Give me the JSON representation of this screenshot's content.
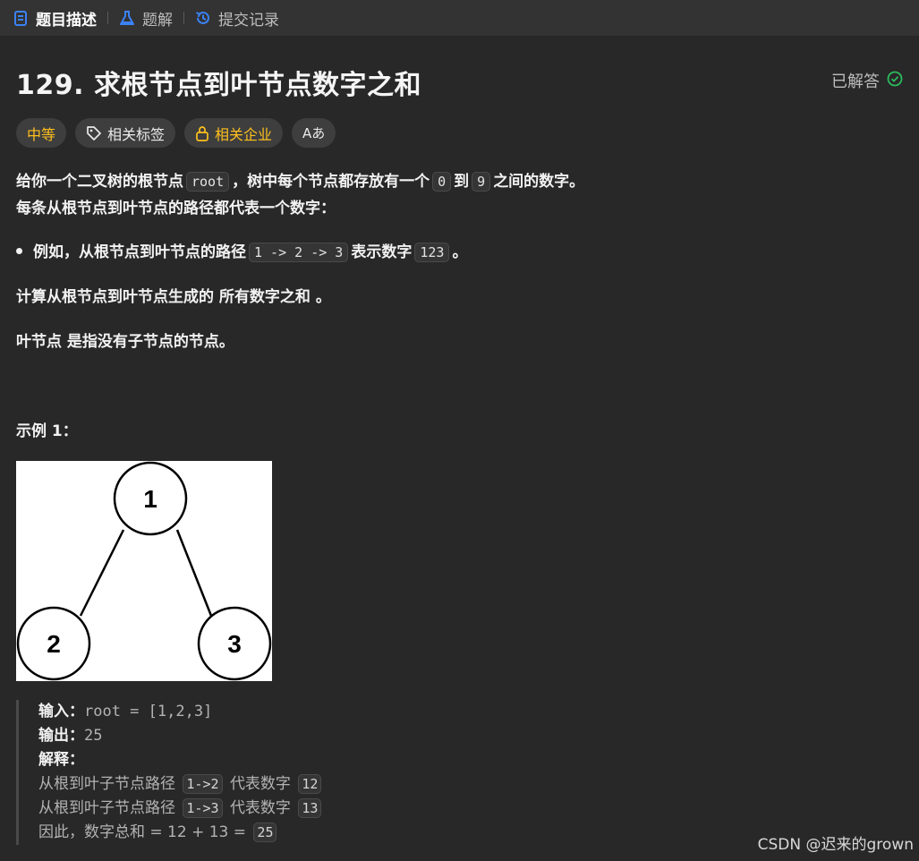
{
  "tabs": [
    {
      "label": "题目描述",
      "icon": "document-icon",
      "active": true
    },
    {
      "label": "题解",
      "icon": "flask-icon",
      "active": false
    },
    {
      "label": "提交记录",
      "icon": "history-icon",
      "active": false
    }
  ],
  "problem": {
    "title": "129. 求根节点到叶节点数字之和",
    "status": "已解答"
  },
  "tags": {
    "difficulty": "中等",
    "related_tags": "相关标签",
    "companies": "相关企业",
    "translate": "Aあ"
  },
  "description": {
    "p1_a": "给你一个二叉树的根节点",
    "p1_code": "root",
    "p1_b": "，树中每个节点都存放有一个",
    "p1_code2": "0",
    "p1_c": "到",
    "p1_code3": "9",
    "p1_d": "之间的数字。",
    "p2": "每条从根节点到叶节点的路径都代表一个数字：",
    "bullet_a": "例如，从根节点到叶节点的路径",
    "bullet_code": "1 -> 2 -> 3",
    "bullet_b": "表示数字",
    "bullet_code2": "123",
    "bullet_c": "。",
    "p3_a": "计算从根节点到叶节点生成的",
    "p3_b": "所有数字之和",
    "p3_c": "。",
    "p4_a": "叶节点",
    "p4_b": "是指没有子节点的节点。"
  },
  "example": {
    "heading": "示例 1：",
    "tree": {
      "root": "1",
      "left": "2",
      "right": "3"
    },
    "input_label": "输入：",
    "input_value": "root = [1,2,3]",
    "output_label": "输出：",
    "output_value": "25",
    "explain_label": "解释：",
    "line1_text": "从根到叶子节点路径",
    "line1_path": "1->2",
    "line1_mid": "代表数字",
    "line1_num": "12",
    "line2_text": "从根到叶子节点路径",
    "line2_path": "1->3",
    "line2_mid": "代表数字",
    "line2_num": "13",
    "line3_text": "因此，数字总和 = 12 + 13 =",
    "line3_num": "25"
  },
  "watermark": "CSDN @迟来的grown"
}
